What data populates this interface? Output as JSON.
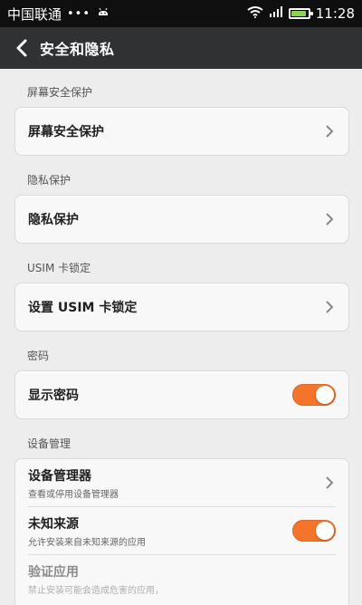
{
  "status_bar": {
    "carrier": "中国联通",
    "time": "11:28"
  },
  "header": {
    "title": "安全和隐私"
  },
  "sections": [
    {
      "title": "屏幕安全保护",
      "items": [
        {
          "label": "屏幕安全保护"
        }
      ]
    },
    {
      "title": "隐私保护",
      "items": [
        {
          "label": "隐私保护"
        }
      ]
    },
    {
      "title": "USIM 卡锁定",
      "items": [
        {
          "label": "设置 USIM 卡锁定"
        }
      ]
    },
    {
      "title": "密码",
      "items": [
        {
          "label": "显示密码",
          "toggle": "on"
        }
      ]
    },
    {
      "title": "设备管理",
      "items": [
        {
          "label": "设备管理器",
          "subtitle": "查看或停用设备管理器"
        },
        {
          "label": "未知来源",
          "subtitle": "允许安装来自未知来源的应用",
          "toggle": "on"
        },
        {
          "label": "验证应用",
          "subtitle": "禁止安装可能会造成危害的应用，"
        }
      ]
    }
  ],
  "colors": {
    "accent": "#f3742a",
    "header_bg": "#2f3133",
    "status_bg": "#0f0f0f"
  },
  "icons": {
    "back": "chevron-left-icon",
    "chevron": "chevron-right-icon",
    "wifi": "wifi-icon",
    "signal": "signal-icon",
    "battery": "battery-icon",
    "android": "android-icon"
  }
}
